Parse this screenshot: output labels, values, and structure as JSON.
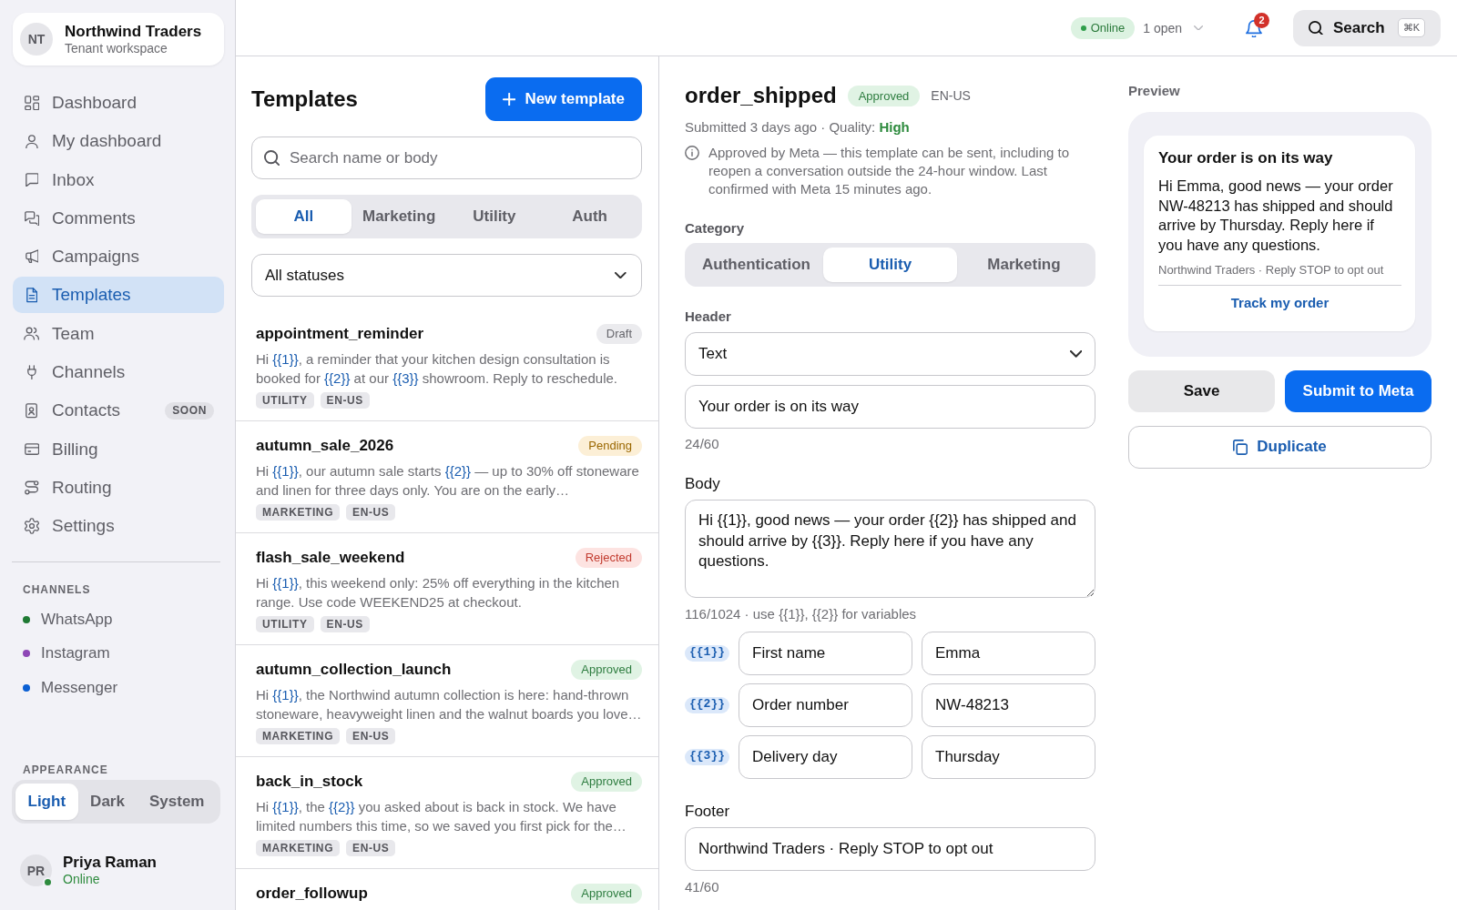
{
  "workspace": {
    "initials": "NT",
    "name": "Northwind Traders",
    "subtitle": "Tenant workspace"
  },
  "nav": [
    {
      "label": "Dashboard",
      "selected": false
    },
    {
      "label": "My dashboard",
      "selected": false
    },
    {
      "label": "Inbox",
      "selected": false
    },
    {
      "label": "Comments",
      "selected": false
    },
    {
      "label": "Campaigns",
      "selected": false
    },
    {
      "label": "Templates",
      "selected": true
    },
    {
      "label": "Team",
      "selected": false
    },
    {
      "label": "Channels",
      "selected": false
    },
    {
      "label": "Contacts",
      "selected": false,
      "badge": "SOON"
    },
    {
      "label": "Billing",
      "selected": false
    },
    {
      "label": "Routing",
      "selected": false
    },
    {
      "label": "Settings",
      "selected": false
    }
  ],
  "channels": {
    "heading": "CHANNELS",
    "items": [
      {
        "label": "WhatsApp",
        "color": "#1f7a34"
      },
      {
        "label": "Instagram",
        "color": "#8e47b6"
      },
      {
        "label": "Messenger",
        "color": "#0b5fd3"
      }
    ]
  },
  "appearance": {
    "heading": "APPEARANCE",
    "options": [
      {
        "label": "Light",
        "selected": true
      },
      {
        "label": "Dark",
        "selected": false
      },
      {
        "label": "System",
        "selected": false
      }
    ]
  },
  "user": {
    "initials": "PR",
    "name": "Priya Raman",
    "status": "Online",
    "online": true
  },
  "topbar": {
    "presence": "Online",
    "open_conversations": "1 open",
    "notifications": "2",
    "search": {
      "label": "Search",
      "shortcut": "⌘K"
    }
  },
  "templates": {
    "title": "Templates",
    "new_button": "New template",
    "search": {
      "placeholder": "Search name or body"
    },
    "filters": [
      {
        "label": "All",
        "selected": true
      },
      {
        "label": "Marketing",
        "selected": false
      },
      {
        "label": "Utility",
        "selected": false
      },
      {
        "label": "Auth",
        "selected": false
      }
    ],
    "status_filter": "All statuses",
    "items": [
      {
        "name": "appointment_reminder",
        "selected": false,
        "badge": {
          "label": "Draft",
          "kind": "draft"
        },
        "body": [
          {
            "kind": "text",
            "text": "Hi "
          },
          {
            "kind": "variable",
            "text": "{{1}}"
          },
          {
            "kind": "text",
            "text": ", a reminder that your kitchen design consultation is booked for "
          },
          {
            "kind": "variable",
            "text": "{{2}}"
          },
          {
            "kind": "text",
            "text": " at our "
          },
          {
            "kind": "variable",
            "text": "{{3}}"
          },
          {
            "kind": "text",
            "text": " showroom. Reply to reschedule."
          }
        ],
        "tags": [
          "UTILITY",
          "EN-US"
        ]
      },
      {
        "name": "autumn_sale_2026",
        "selected": false,
        "badge": {
          "label": "Pending",
          "kind": "pending"
        },
        "body": [
          {
            "kind": "text",
            "text": "Hi "
          },
          {
            "kind": "variable",
            "text": "{{1}}"
          },
          {
            "kind": "text",
            "text": ", our autumn sale starts "
          },
          {
            "kind": "variable",
            "text": "{{2}}"
          },
          {
            "kind": "text",
            "text": " — up to 30% off stoneware and linen for three days only. You are on the early…"
          }
        ],
        "tags": [
          "MARKETING",
          "EN-US"
        ]
      },
      {
        "name": "flash_sale_weekend",
        "selected": false,
        "badge": {
          "label": "Rejected",
          "kind": "rejected"
        },
        "body": [
          {
            "kind": "text",
            "text": "Hi "
          },
          {
            "kind": "variable",
            "text": "{{1}}"
          },
          {
            "kind": "text",
            "text": ", this weekend only: 25% off everything in the kitchen range. Use code WEEKEND25 at checkout."
          }
        ],
        "tags": [
          "UTILITY",
          "EN-US"
        ]
      },
      {
        "name": "autumn_collection_launch",
        "selected": false,
        "badge": {
          "label": "Approved",
          "kind": "approved"
        },
        "body": [
          {
            "kind": "text",
            "text": "Hi "
          },
          {
            "kind": "variable",
            "text": "{{1}}"
          },
          {
            "kind": "text",
            "text": ", the Northwind autumn collection is here: hand-thrown stoneware, heavyweight linen and the walnut boards you love…"
          }
        ],
        "tags": [
          "MARKETING",
          "EN-US"
        ]
      },
      {
        "name": "back_in_stock",
        "selected": false,
        "badge": {
          "label": "Approved",
          "kind": "approved"
        },
        "body": [
          {
            "kind": "text",
            "text": "Hi "
          },
          {
            "kind": "variable",
            "text": "{{1}}"
          },
          {
            "kind": "text",
            "text": ", the "
          },
          {
            "kind": "variable",
            "text": "{{2}}"
          },
          {
            "kind": "text",
            "text": " you asked about is back in stock. We have limited numbers this time, so we saved you first pick for the…"
          }
        ],
        "tags": [
          "MARKETING",
          "EN-US"
        ]
      },
      {
        "name": "order_followup",
        "selected": false,
        "badge": {
          "label": "Approved",
          "kind": "approved"
        }
      }
    ]
  },
  "editor": {
    "name": "order_shipped",
    "status": {
      "label": "Approved",
      "kind": "approved"
    },
    "locale": "EN-US",
    "meta": "Submitted 3 days ago · Quality: **High**",
    "notice": "Approved by Meta — this template can be sent, including to reopen a conversation outside the 24-hour window. Last confirmed with Meta 15 minutes ago.",
    "category": {
      "label": "Category",
      "options": [
        {
          "label": "Authentication",
          "selected": false
        },
        {
          "label": "Utility",
          "selected": true
        },
        {
          "label": "Marketing",
          "selected": false
        }
      ]
    },
    "header": {
      "label": "Header",
      "type": "Text",
      "value": "Your order is on its way",
      "counter": "24/60"
    },
    "body": {
      "label": "Body",
      "value": "Hi {{1}}, good news — your order {{2}} has shipped and should arrive by {{3}}. Reply here if you have any questions.",
      "hint": "116/1024 · use {{1}}, {{2}} for variables"
    },
    "variables": [
      {
        "token": "{{1}}",
        "name": "First name",
        "sample": "Emma"
      },
      {
        "token": "{{2}}",
        "name": "Order number",
        "sample": "NW-48213"
      },
      {
        "token": "{{3}}",
        "name": "Delivery day",
        "sample": "Thursday"
      }
    ],
    "footer": {
      "label": "Footer",
      "value": "Northwind Traders · Reply STOP to opt out",
      "counter": "41/60"
    }
  },
  "preview": {
    "label": "Preview",
    "title": "Your order is on its way",
    "body": "Hi Emma, good news — your order NW-48213 has shipped and should arrive by Thursday. Reply here if you have any questions.",
    "footer": "Northwind Traders · Reply STOP to opt out",
    "button": "Track my order"
  },
  "actions": {
    "save": "Save",
    "submit": "Submit to Meta",
    "duplicate": "Duplicate"
  }
}
